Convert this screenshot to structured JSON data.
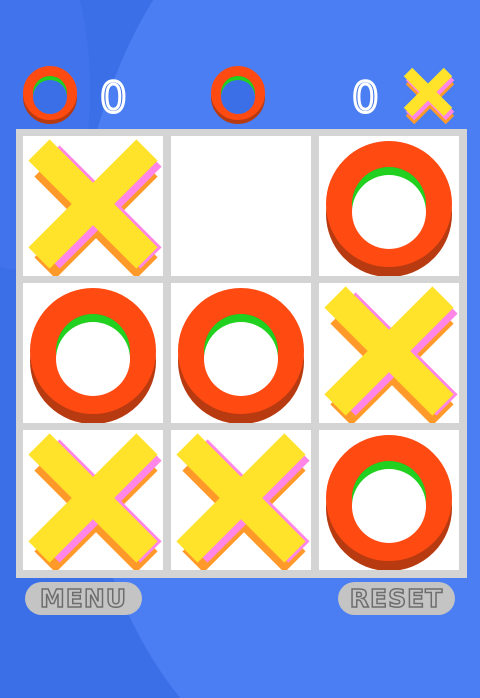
{
  "colors": {
    "background": "#3b6fe8",
    "o_ring": "#ff4a12",
    "o_ring_shadow": "#b83a10",
    "o_inner_accent": "#22d11f",
    "x_main": "#ffe22a",
    "x_pink": "#ff86e6",
    "x_orange": "#ff9a2a",
    "board_grid": "#d4d4d4",
    "button_fill": "#c4c4c4"
  },
  "scoreboard": {
    "o_score": "0",
    "x_score": "0",
    "turn_indicator": "O"
  },
  "board": {
    "cells": [
      "X",
      "",
      "O",
      "O",
      "O",
      "X",
      "X",
      "X",
      "O"
    ]
  },
  "buttons": {
    "menu_label": "MENU",
    "reset_label": "RESET"
  }
}
